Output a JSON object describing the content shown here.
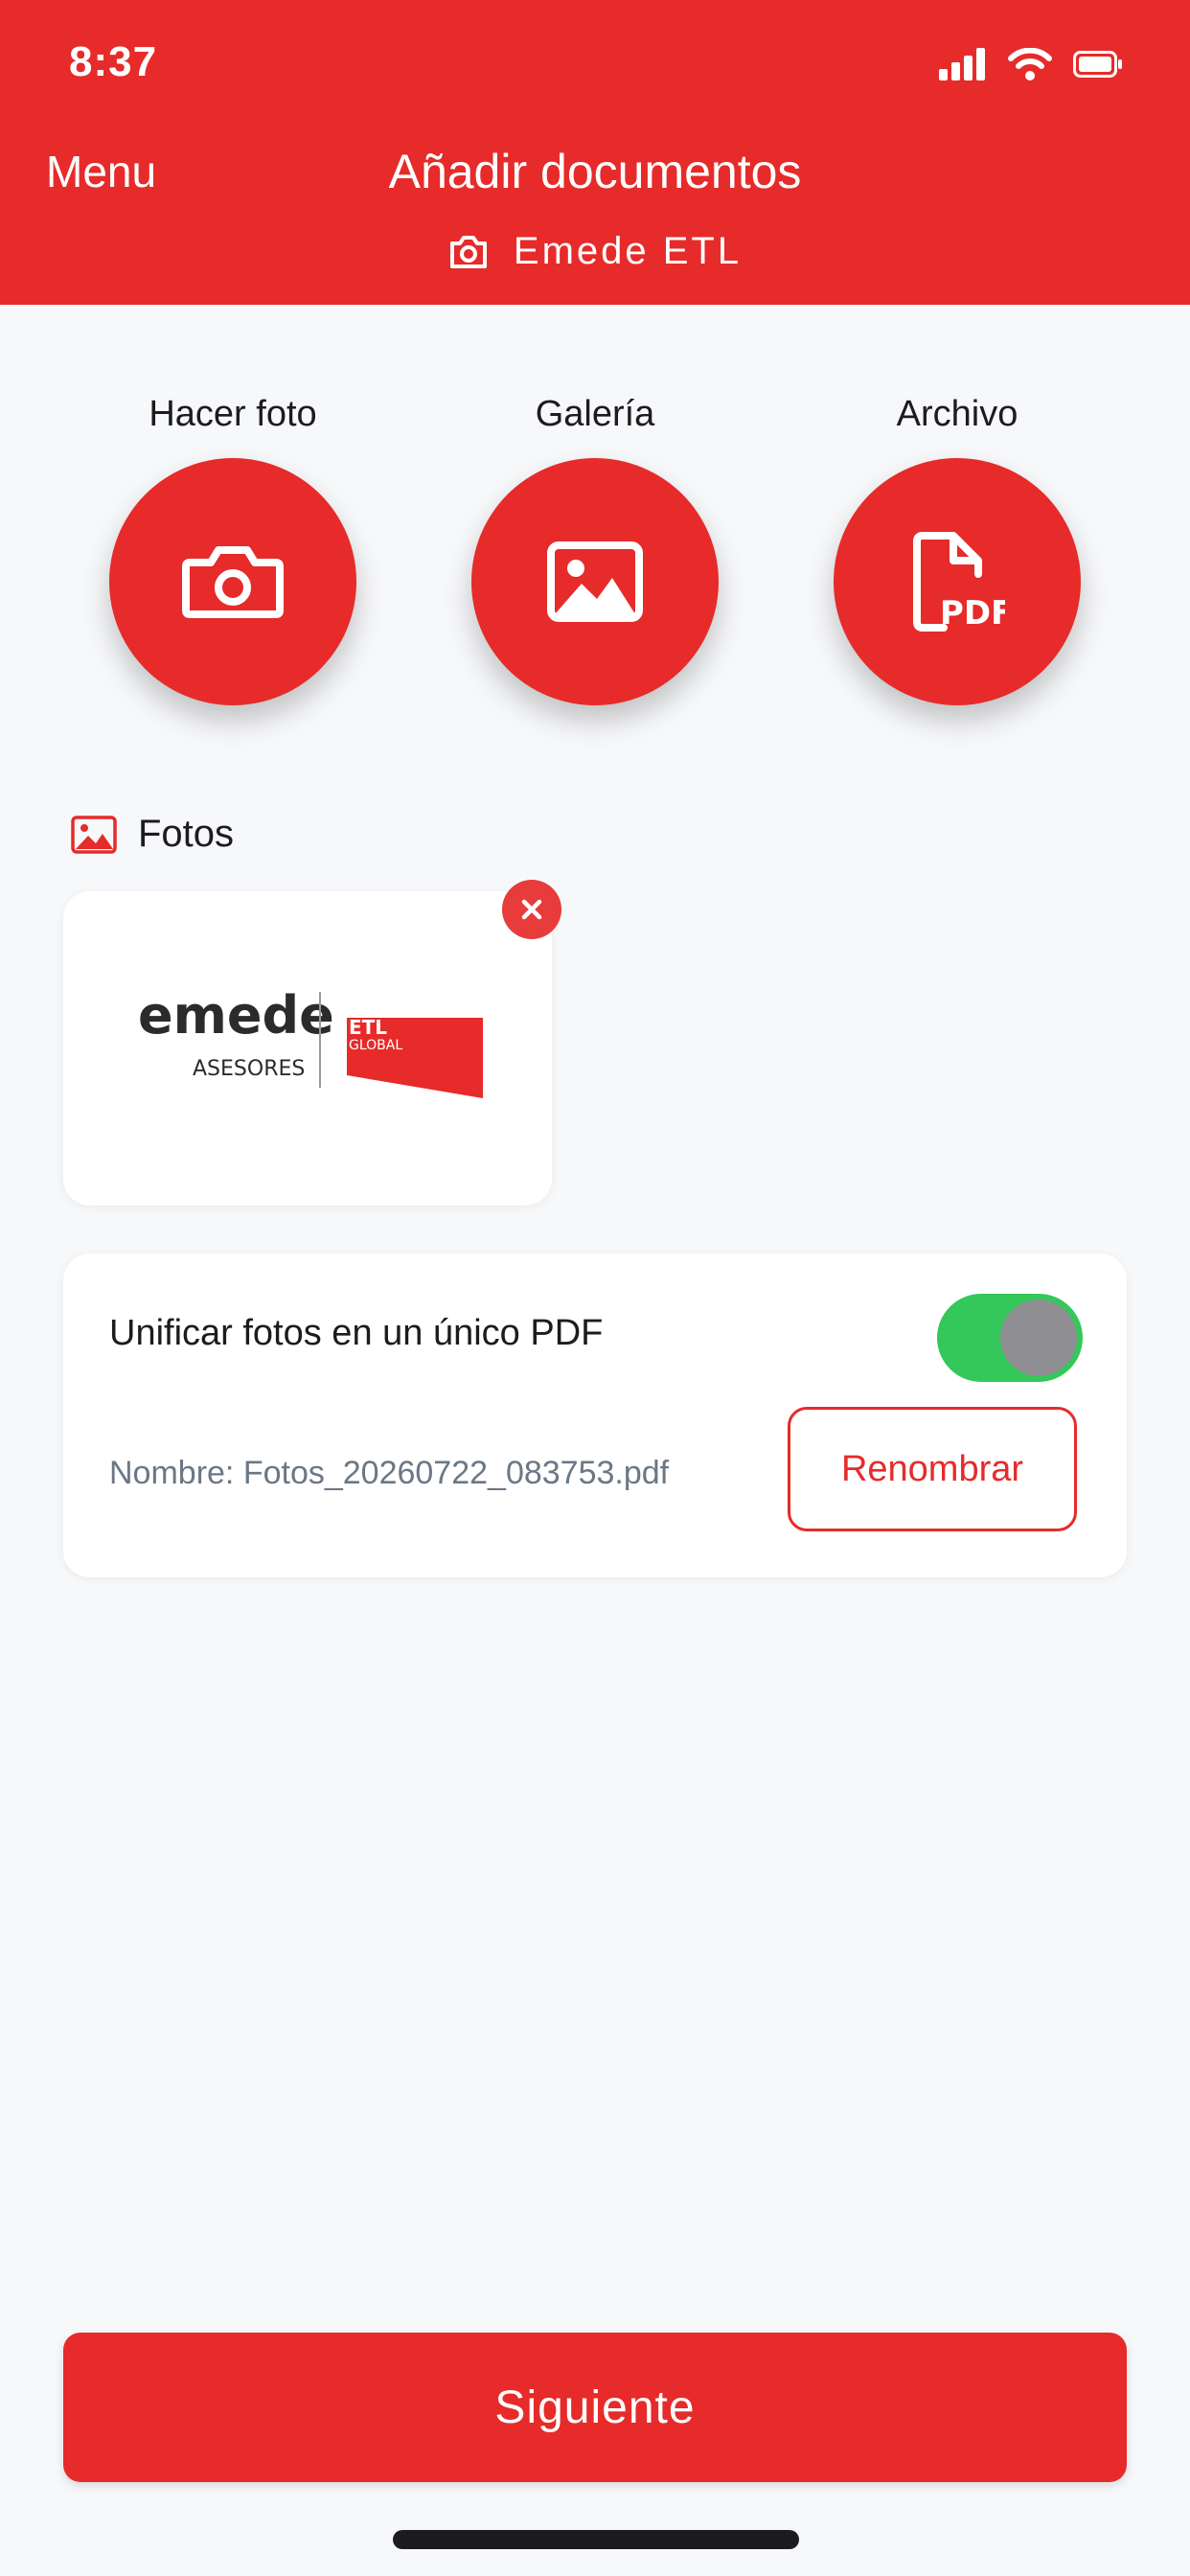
{
  "status_bar": {
    "time": "8:37"
  },
  "header": {
    "menu_label": "Menu",
    "title": "Añadir documentos",
    "subtitle": "Emede ETL"
  },
  "actions": [
    {
      "label": "Hacer foto",
      "icon": "camera-icon"
    },
    {
      "label": "Galería",
      "icon": "image-icon"
    },
    {
      "label": "Archivo",
      "icon": "pdf-file-icon"
    }
  ],
  "fotos": {
    "section_label": "Fotos",
    "thumbnail": {
      "logo_main": "emede",
      "logo_sub": "ASESORES",
      "logo_badge_top": "ETL",
      "logo_badge_bottom": "GLOBAL"
    }
  },
  "unify": {
    "label": "Unificar fotos en un único PDF",
    "toggle_on": true,
    "filename": "Nombre: Fotos_20260722_083753.pdf",
    "rename_label": "Renombrar"
  },
  "next_label": "Siguiente",
  "colors": {
    "brand_red": "#e62b2a",
    "toggle_green": "#34c759",
    "background": "#f7f8fa"
  }
}
